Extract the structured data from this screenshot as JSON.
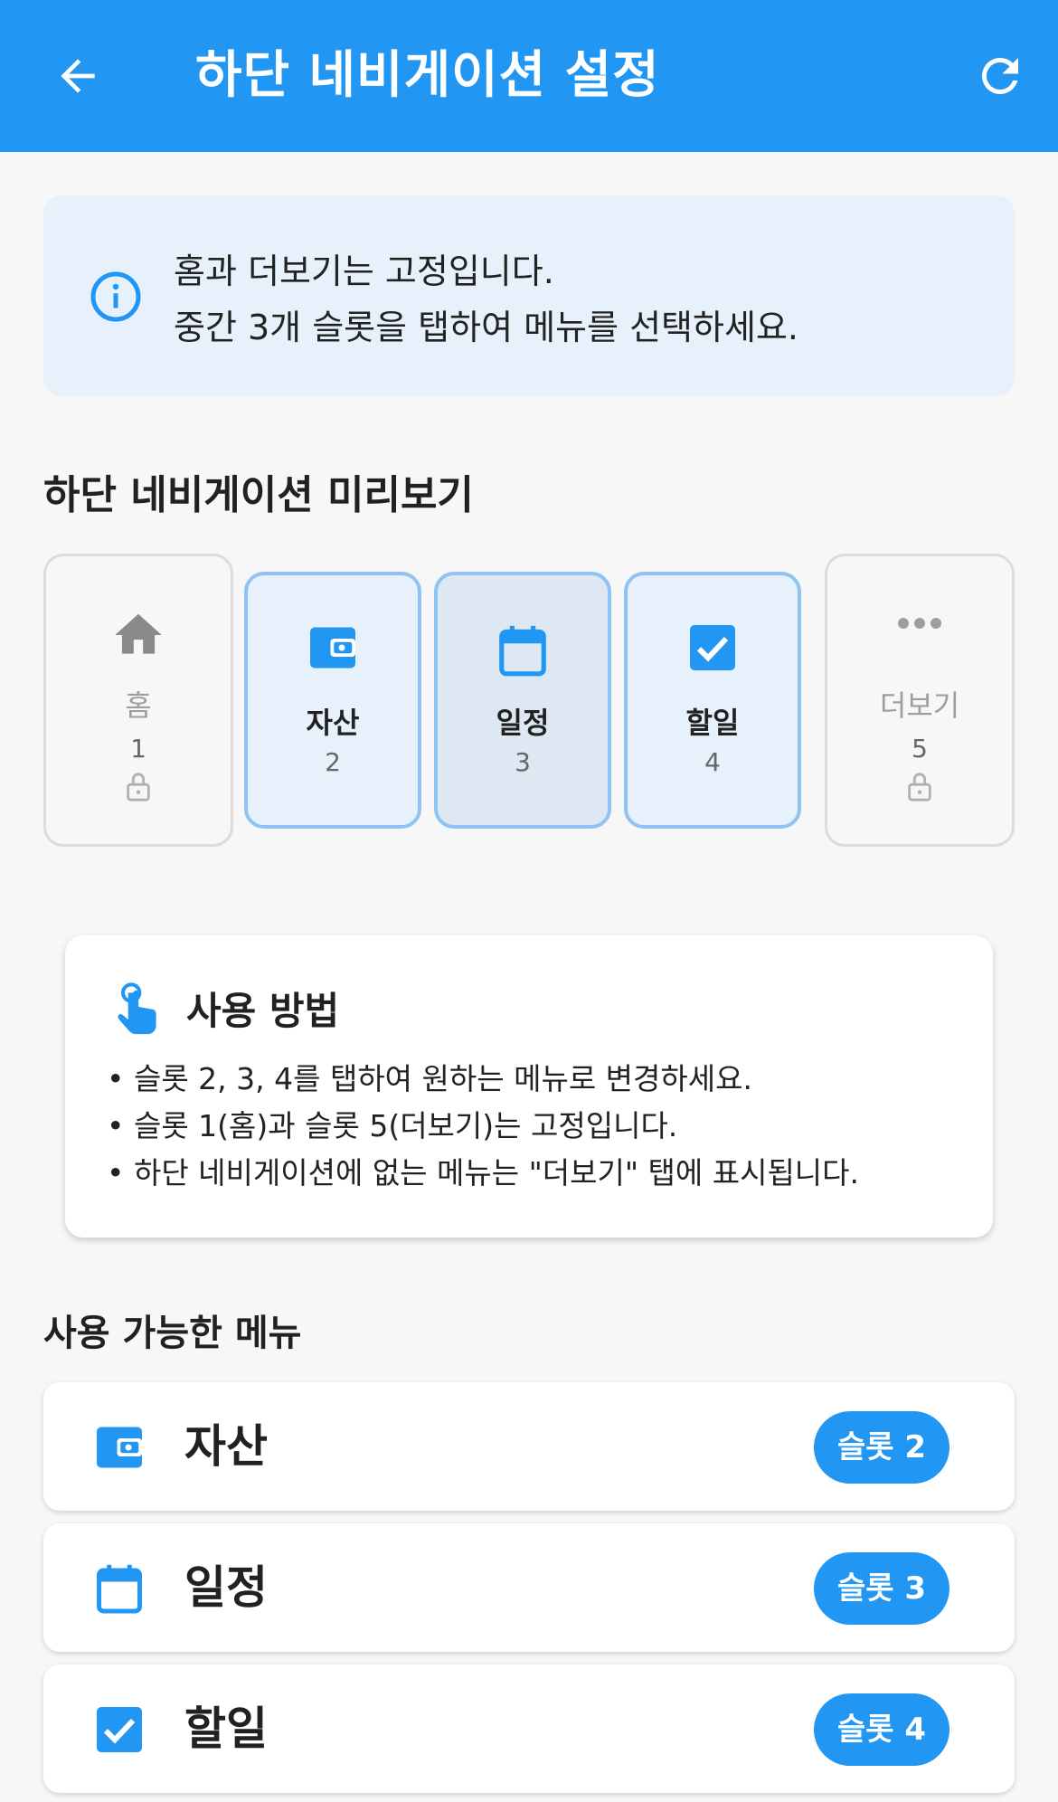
{
  "appbar": {
    "title": "하단 네비게이션 설정",
    "back_icon": "arrow-back-icon",
    "refresh_icon": "refresh-icon",
    "color": "#2196f3"
  },
  "info": {
    "icon": "info-icon",
    "line1": "홈과 더보기는 고정입니다.",
    "line2": "중간 3개 슬롯을 탭하여 메뉴를 선택하세요."
  },
  "preview": {
    "title": "하단 네비게이션 미리보기",
    "slots": [
      {
        "label": "홈",
        "number": "1",
        "icon": "home-icon",
        "locked": true
      },
      {
        "label": "자산",
        "number": "2",
        "icon": "wallet-icon",
        "locked": false
      },
      {
        "label": "일정",
        "number": "3",
        "icon": "calendar-icon",
        "locked": false,
        "selected": true
      },
      {
        "label": "할일",
        "number": "4",
        "icon": "checkbox-icon",
        "locked": false
      },
      {
        "label": "더보기",
        "number": "5",
        "icon": "more-horiz-icon",
        "locked": true
      }
    ]
  },
  "howto": {
    "icon": "touch-hand-icon",
    "title": "사용 방법",
    "bullets": [
      "• 슬롯 2, 3, 4를 탭하여 원하는 메뉴로 변경하세요.",
      "• 슬롯 1(홈)과 슬롯 5(더보기)는 고정입니다.",
      "• 하단 네비게이션에 없는 메뉴는 \"더보기\" 탭에 표시됩니다."
    ]
  },
  "menu": {
    "title": "사용 가능한 메뉴",
    "items": [
      {
        "label": "자산",
        "badge": "슬롯 2",
        "icon": "wallet-icon"
      },
      {
        "label": "일정",
        "badge": "슬롯 3",
        "icon": "calendar-icon"
      },
      {
        "label": "할일",
        "badge": "슬롯 4",
        "icon": "checkbox-icon"
      }
    ]
  }
}
